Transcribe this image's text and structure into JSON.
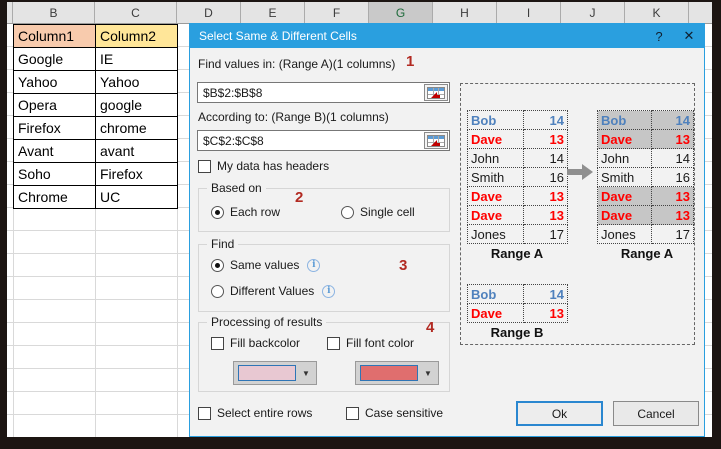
{
  "spreadsheet": {
    "column_headers": [
      "B",
      "C",
      "D",
      "E",
      "F",
      "G",
      "H",
      "I",
      "J",
      "K"
    ],
    "selected_column": "G",
    "table": {
      "headers": [
        {
          "text": "Column1",
          "bg": "#F8CBAD"
        },
        {
          "text": "Column2",
          "bg": "#FFE699"
        }
      ],
      "rows": [
        [
          "Google",
          "IE"
        ],
        [
          "Yahoo",
          "Yahoo"
        ],
        [
          "Opera",
          "google"
        ],
        [
          "Firefox",
          "chrome"
        ],
        [
          "Avant",
          "avant"
        ],
        [
          "Soho",
          "Firefox"
        ],
        [
          "Chrome",
          "UC"
        ]
      ]
    }
  },
  "dialog": {
    "title": "Select Same & Different Cells",
    "help_button": "?",
    "close_button": "✕",
    "range_a_label": "Find values in: (Range A)(1 columns)",
    "range_a_value": "$B$2:$B$8",
    "range_b_label": "According to: (Range B)(1 columns)",
    "range_b_value": "$C$2:$C$8",
    "step1": "1",
    "step2": "2",
    "step3": "3",
    "step4": "4",
    "headers_checkbox_label": "My data has headers",
    "based_on": {
      "legend": "Based on",
      "option_each_row": "Each row",
      "option_single_cell": "Single cell",
      "selected": "Each row"
    },
    "find": {
      "legend": "Find",
      "option_same": "Same values",
      "option_different": "Different Values",
      "selected": "Same values"
    },
    "processing": {
      "legend": "Processing of results",
      "fill_backcolor_label": "Fill backcolor",
      "fill_font_color_label": "Fill font color",
      "backcolor_swatch": "#E8C8D2",
      "fontcolor_swatch": "#E06E6E"
    },
    "select_entire_rows_label": "Select entire rows",
    "case_sensitive_label": "Case sensitive",
    "ok_label": "Ok",
    "cancel_label": "Cancel"
  },
  "illustration": {
    "range_a_label": "Range A",
    "range_b_label": "Range B",
    "range_a_rows": [
      {
        "name": "Bob",
        "value": "14",
        "color": "blue",
        "highlight": true
      },
      {
        "name": "Dave",
        "value": "13",
        "color": "red",
        "highlight": true
      },
      {
        "name": "John",
        "value": "14",
        "color": "black",
        "highlight": false
      },
      {
        "name": "Smith",
        "value": "16",
        "color": "black",
        "highlight": false
      },
      {
        "name": "Dave",
        "value": "13",
        "color": "red",
        "highlight": true
      },
      {
        "name": "Dave",
        "value": "13",
        "color": "red",
        "highlight": true
      },
      {
        "name": "Jones",
        "value": "17",
        "color": "black",
        "highlight": false
      }
    ],
    "range_b_rows": [
      {
        "name": "Bob",
        "value": "14",
        "color": "blue"
      },
      {
        "name": "Dave",
        "value": "13",
        "color": "red"
      }
    ],
    "colors": {
      "blue": "#4F81BD",
      "red": "#FF0000",
      "black": "#1a1a1a",
      "highlight_bg": "#C6C6C6"
    }
  }
}
